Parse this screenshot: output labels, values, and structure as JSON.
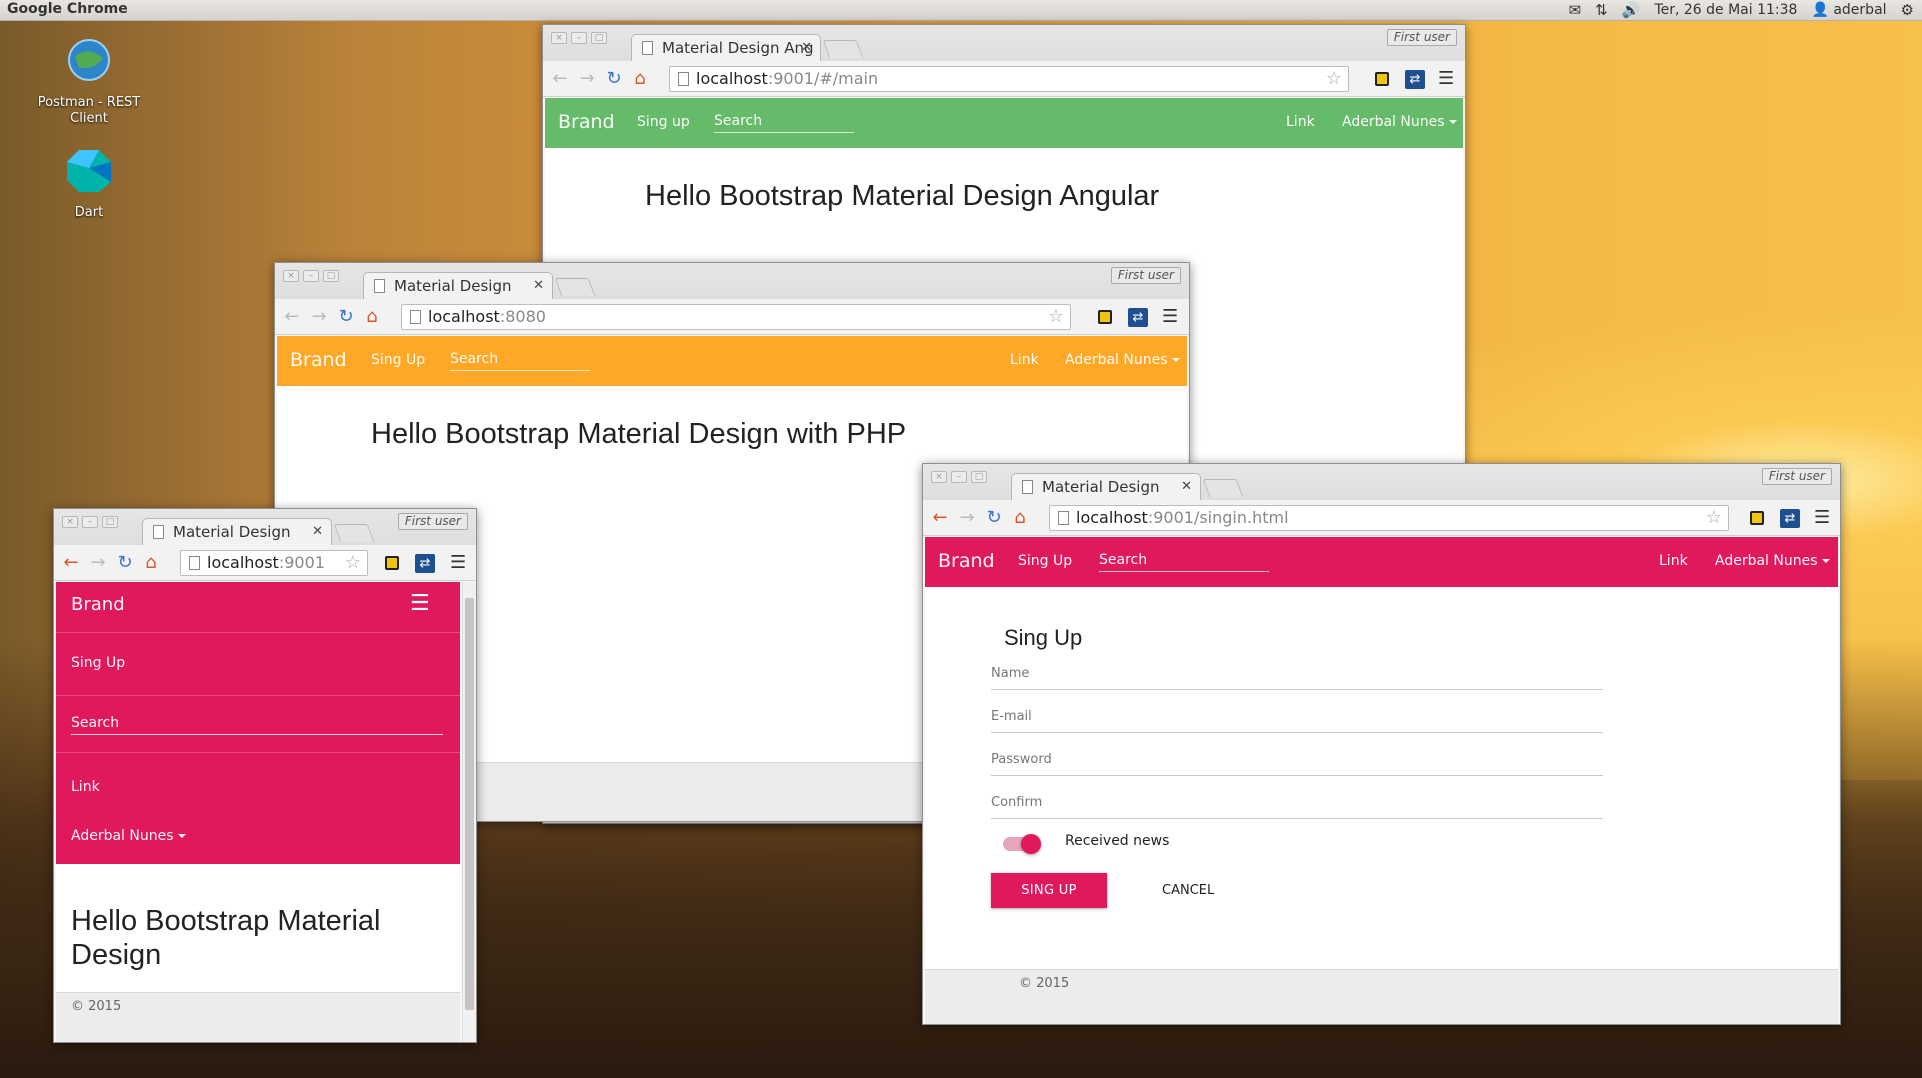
{
  "system": {
    "app_name": "Google Chrome",
    "datetime": "Ter, 26 de Mai 11:38",
    "user": "aderbal"
  },
  "desktop_icons": [
    {
      "label": "Postman - REST Client",
      "icon": "postman-icon"
    },
    {
      "label": "Dart",
      "icon": "dart-icon"
    }
  ],
  "windows": {
    "angular": {
      "profile": "First user",
      "tab_title": "Material Design Ang",
      "url_host": "localhost",
      "url_path": ":9001/#/main",
      "nav_color": "#66bb6a",
      "brand": "Brand",
      "nav_item": "Sing up",
      "search_placeholder": "Search",
      "link": "Link",
      "user_menu": "Aderbal Nunes",
      "heading": "Hello Bootstrap Material Design Angular"
    },
    "php": {
      "profile": "First user",
      "tab_title": "Material Design",
      "url_host": "localhost",
      "url_path": ":8080",
      "nav_color": "#ffa726",
      "brand": "Brand",
      "nav_item": "Sing Up",
      "search_placeholder": "Search",
      "link": "Link",
      "user_menu": "Aderbal Nunes",
      "heading": "Hello Bootstrap Material Design with PHP"
    },
    "mobile": {
      "profile": "First user",
      "tab_title": "Material Design",
      "url_host": "localhost",
      "url_path": ":9001",
      "nav_color": "#e0195f",
      "brand": "Brand",
      "nav_item": "Sing Up",
      "search_placeholder": "Search",
      "link": "Link",
      "user_menu": "Aderbal Nunes",
      "heading": "Hello Bootstrap Material Design",
      "footer": "© 2015"
    },
    "signup": {
      "profile": "First user",
      "tab_title": "Material Design",
      "url_host": "localhost",
      "url_path": ":9001/singin.html",
      "nav_color": "#e0195f",
      "brand": "Brand",
      "nav_item": "Sing Up",
      "search_placeholder": "Search",
      "link": "Link",
      "user_menu": "Aderbal Nunes",
      "form_title": "Sing Up",
      "fields": {
        "name": "Name",
        "email": "E-mail",
        "password": "Password",
        "confirm": "Confirm"
      },
      "toggle_label": "Received news",
      "toggle_on": true,
      "submit": "SING UP",
      "cancel": "CANCEL",
      "footer": "© 2015"
    }
  }
}
